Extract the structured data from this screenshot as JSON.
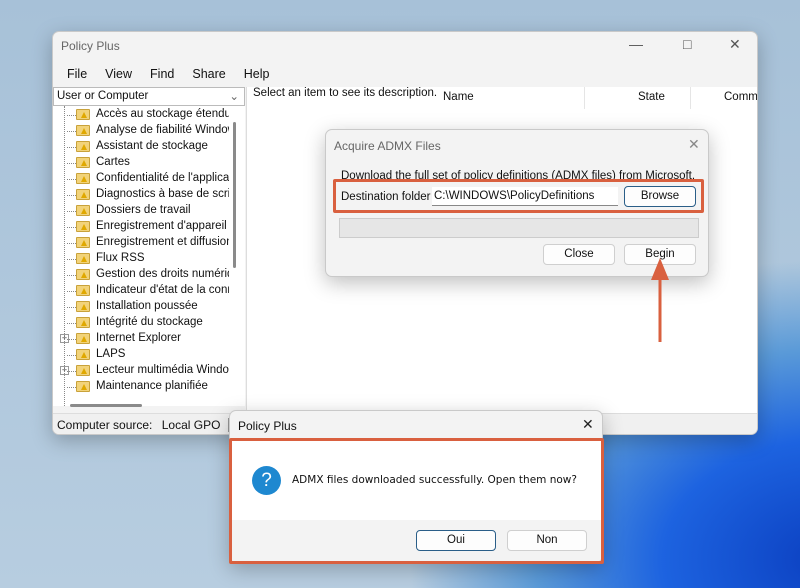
{
  "main_window": {
    "title": "Policy Plus",
    "menu": [
      "File",
      "View",
      "Find",
      "Share",
      "Help"
    ],
    "scope_combo": "User or Computer",
    "tree_items": [
      {
        "label": "Accès au stockage étendu",
        "expandable": false
      },
      {
        "label": "Analyse de fiabilité Windows",
        "expandable": false
      },
      {
        "label": "Assistant de stockage",
        "expandable": false
      },
      {
        "label": "Cartes",
        "expandable": false
      },
      {
        "label": "Confidentialité de l'application",
        "expandable": false
      },
      {
        "label": "Diagnostics à base de scripts",
        "expandable": false
      },
      {
        "label": "Dossiers de travail",
        "expandable": false
      },
      {
        "label": "Enregistrement d'appareil",
        "expandable": false
      },
      {
        "label": "Enregistrement et diffusion de jeux",
        "expandable": false
      },
      {
        "label": "Flux RSS",
        "expandable": false
      },
      {
        "label": "Gestion des droits numériques",
        "expandable": false
      },
      {
        "label": "Indicateur d'état de la connectivité",
        "expandable": false
      },
      {
        "label": "Installation poussée",
        "expandable": false
      },
      {
        "label": "Intégrité du stockage",
        "expandable": false
      },
      {
        "label": "Internet Explorer",
        "expandable": true
      },
      {
        "label": "LAPS",
        "expandable": false
      },
      {
        "label": "Lecteur multimédia Windows",
        "expandable": true
      },
      {
        "label": "Maintenance planifiée",
        "expandable": false
      }
    ],
    "description": "Select an item to see its description.",
    "columns": [
      "Name",
      "State",
      "Comment"
    ],
    "status": {
      "label": "Computer source:",
      "value": "Local GPO",
      "extra": "U"
    }
  },
  "admx_dialog": {
    "title": "Acquire ADMX Files",
    "intro": "Download the full set of policy definitions (ADMX files) from Microsoft.",
    "folder_label": "Destination folder",
    "folder_value": "C:\\WINDOWS\\PolicyDefinitions",
    "browse": "Browse",
    "close": "Close",
    "begin": "Begin"
  },
  "message_box": {
    "title": "Policy Plus",
    "icon": "?",
    "text": "ADMX files downloaded successfully. Open them now?",
    "yes": "Oui",
    "no": "Non"
  },
  "colors": {
    "highlight": "#d9603f",
    "accent": "#1e88d0"
  }
}
